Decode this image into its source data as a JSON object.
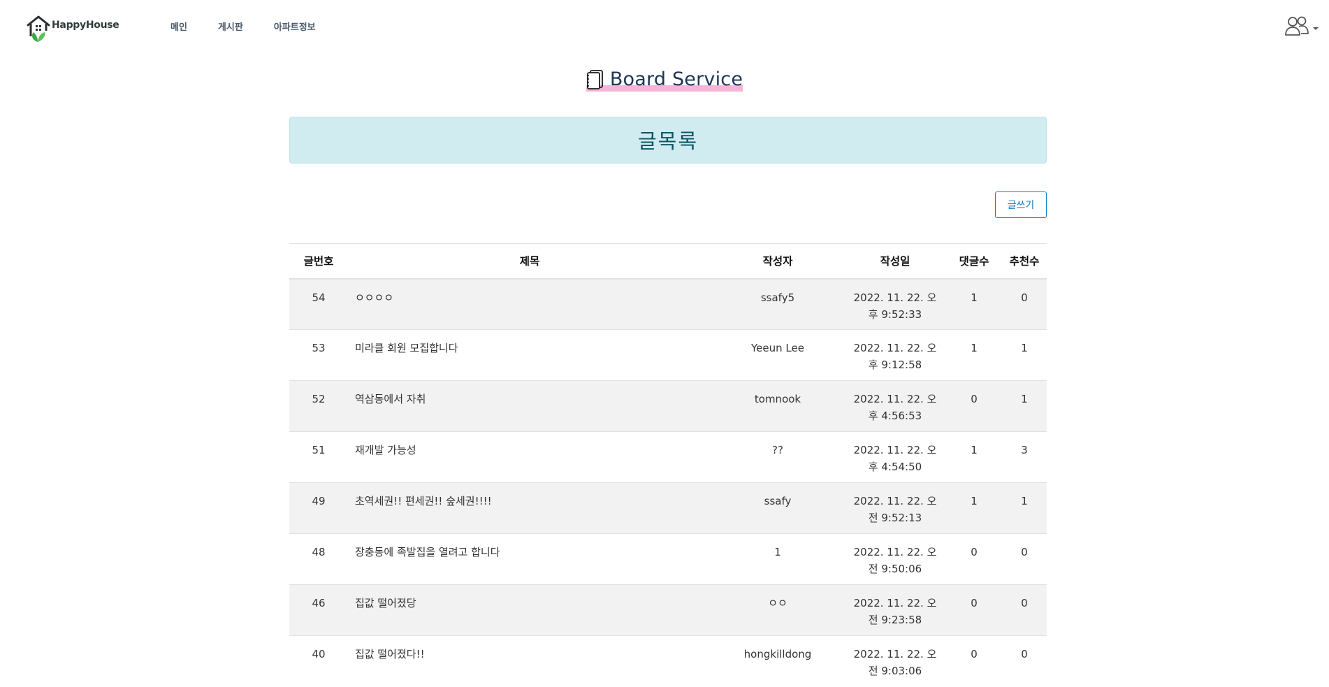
{
  "navbar": {
    "brand_name": "HappyHouse",
    "links": [
      {
        "label": "메인"
      },
      {
        "label": "게시판"
      },
      {
        "label": "아파트정보"
      }
    ]
  },
  "header": {
    "title": "Board Service"
  },
  "alert": {
    "text": "글목록"
  },
  "toolbar": {
    "write_label": "글쓰기"
  },
  "table": {
    "columns": {
      "no": "글번호",
      "title": "제목",
      "author": "작성자",
      "date": "작성일",
      "comments": "댓글수",
      "likes": "추천수"
    },
    "rows": [
      {
        "no": "54",
        "title": "ㅇㅇㅇㅇ",
        "author": "ssafy5",
        "date_line1": "2022. 11. 22. 오",
        "date_line2": "후 9:52:33",
        "comments": "1",
        "likes": "0"
      },
      {
        "no": "53",
        "title": "미라클 회원 모집합니다",
        "author": "Yeeun Lee",
        "date_line1": "2022. 11. 22. 오",
        "date_line2": "후 9:12:58",
        "comments": "1",
        "likes": "1"
      },
      {
        "no": "52",
        "title": "역삼동에서 자취",
        "author": "tomnook",
        "date_line1": "2022. 11. 22. 오",
        "date_line2": "후 4:56:53",
        "comments": "0",
        "likes": "1"
      },
      {
        "no": "51",
        "title": "재개발 가능성",
        "author": "??",
        "date_line1": "2022. 11. 22. 오",
        "date_line2": "후 4:54:50",
        "comments": "1",
        "likes": "3"
      },
      {
        "no": "49",
        "title": "초역세권!! 편세권!! 숲세권!!!!",
        "author": "ssafy",
        "date_line1": "2022. 11. 22. 오",
        "date_line2": "전 9:52:13",
        "comments": "1",
        "likes": "1"
      },
      {
        "no": "48",
        "title": "장충동에 족발집을 열려고 합니다",
        "author": "1",
        "date_line1": "2022. 11. 22. 오",
        "date_line2": "전 9:50:06",
        "comments": "0",
        "likes": "0"
      },
      {
        "no": "46",
        "title": "집값 떨어졌당",
        "author": "ㅇㅇ",
        "date_line1": "2022. 11. 22. 오",
        "date_line2": "전 9:23:58",
        "comments": "0",
        "likes": "0"
      },
      {
        "no": "40",
        "title": "집값 떨어졌다!!",
        "author": "hongkilldong",
        "date_line1": "2022. 11. 22. 오",
        "date_line2": "전 9:03:06",
        "comments": "0",
        "likes": "0"
      }
    ]
  },
  "colors": {
    "alert_bg": "#d1ecf1",
    "alert_text": "#0c5460",
    "title_underline": "#f4b5d7",
    "primary": "#0d7bc5",
    "row_stripe": "#f2f2f2"
  },
  "icons": {
    "brand_logo": "house-leaf-icon",
    "title_icon": "notebook-icon",
    "user_menu": "users-icon",
    "dropdown": "caret-down-icon"
  }
}
